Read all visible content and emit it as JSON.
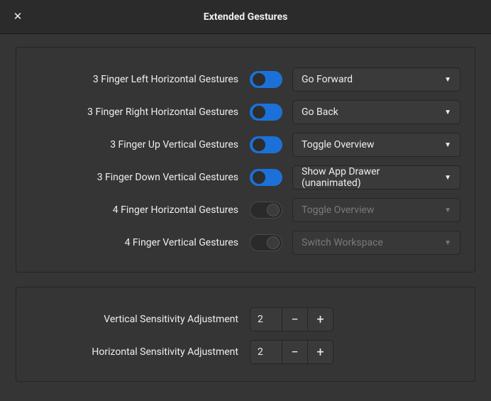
{
  "window": {
    "title": "Extended Gestures"
  },
  "gestures": [
    {
      "label": "3 Finger Left Horizontal Gestures",
      "enabled": true,
      "action": "Go Forward"
    },
    {
      "label": "3 Finger Right Horizontal Gestures",
      "enabled": true,
      "action": "Go Back"
    },
    {
      "label": "3 Finger Up Vertical Gestures",
      "enabled": true,
      "action": "Toggle Overview"
    },
    {
      "label": "3 Finger Down Vertical Gestures",
      "enabled": true,
      "action": "Show App Drawer (unanimated)"
    },
    {
      "label": "4 Finger Horizontal Gestures",
      "enabled": false,
      "action": "Toggle Overview"
    },
    {
      "label": "4 Finger Vertical Gestures",
      "enabled": false,
      "action": "Switch Workspace"
    }
  ],
  "sensitivity": {
    "vertical": {
      "label": "Vertical Sensitivity Adjustment",
      "value": "2"
    },
    "horizontal": {
      "label": "Horizontal Sensitivity Adjustment",
      "value": "2"
    }
  }
}
